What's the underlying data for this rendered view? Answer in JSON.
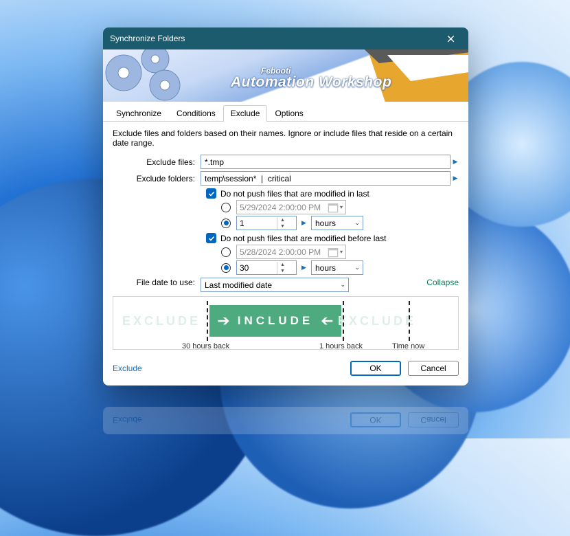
{
  "window": {
    "title": "Synchronize Folders"
  },
  "brand": {
    "small": "Febooti",
    "big": "Automation Workshop"
  },
  "tabs": {
    "synchronize": "Synchronize",
    "conditions": "Conditions",
    "exclude": "Exclude",
    "options": "Options"
  },
  "description": "Exclude files and folders based on their names. Ignore or include files that reside on a certain date range.",
  "labels": {
    "exclude_files": "Exclude files:",
    "exclude_folders": "Exclude folders:",
    "file_date": "File date to use:"
  },
  "fields": {
    "exclude_files": "*.tmp",
    "exclude_folders": "temp\\session*  |  critical"
  },
  "check_modified_in_last": "Do not push files that are modified in last",
  "check_modified_before_last": "Do not push files that are modified before last",
  "date1": "5/29/2024   2:00:00 PM",
  "num1": "1",
  "unit1": "hours",
  "date2": "5/28/2024   2:00:00 PM",
  "num2": "30",
  "unit2": "hours",
  "file_date_value": "Last modified date",
  "collapse": "Collapse",
  "timeline": {
    "exclude": "EXCLUDE",
    "include": "INCLUDE",
    "label_30h": "30 hours back",
    "label_1h": "1 hours back",
    "label_now": "Time now"
  },
  "footer": {
    "link": "Exclude",
    "ok": "OK",
    "cancel": "Cancel"
  }
}
